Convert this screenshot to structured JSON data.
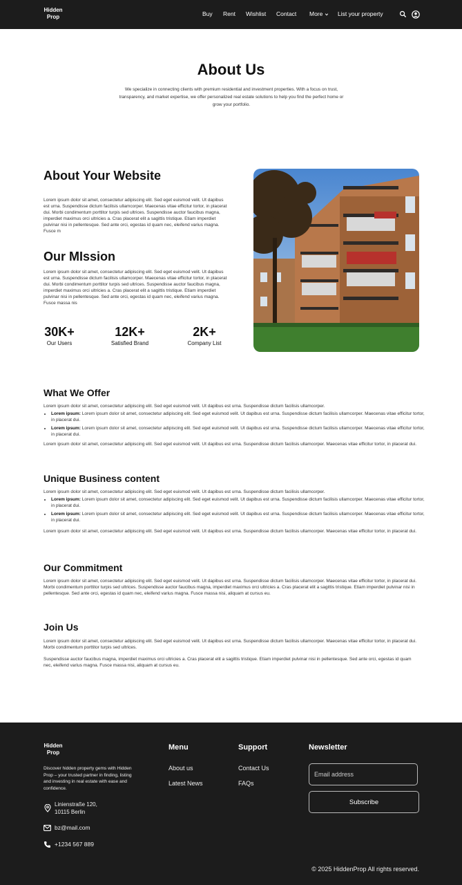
{
  "header": {
    "logo_line1": "Hidden",
    "logo_line2": "Prop",
    "nav": [
      "Buy",
      "Rent",
      "Wishlist",
      "Contact",
      "More",
      "List your property"
    ]
  },
  "hero": {
    "title": "About Us",
    "text": "We specialize in connecting clients with premium residential and investment properties. With a focus on trust, transparency, and market expertise, we offer personalized real estate solutions to help you find the perfect home or grow your portfolio."
  },
  "about": {
    "title": "About Your Website",
    "text": "Lorem ipsum dolor sit amet, consectetur adipiscing elit. Sed eget euismod velit. Ut dapibus est urna. Suspendisse dictum facilisis ullamcorper. Maecenas vitae efficitur tortor, in placerat dui. Morbi condimentum porttitor turpis sed ultrices. Suspendisse auctor faucibus magna, imperdiet maximus orci ultricies a. Cras placerat elit a sagittis tristique. Etiam imperdiet pulvinar nisi in pellentesque. Sed ante orci, egestas id quam nec, eleifend varius magna. Fusce m",
    "mission_title": "Our MIssion",
    "mission_text": "Lorem ipsum dolor sit amet, consectetur adipiscing elit. Sed eget euismod velit. Ut dapibus est urna. Suspendisse dictum facilisis ullamcorper. Maecenas vitae efficitur tortor, in placerat dui. Morbi condimentum porttitor turpis sed ultrices. Suspendisse auctor faucibus magna, imperdiet maximus orci ultricies a. Cras placerat elit a sagittis tristique. Etiam imperdiet pulvinar nisi in pellentesque. Sed ante orci, egestas id quam nec, eleifend varius magna. Fusce massa nis"
  },
  "stats": [
    {
      "value": "30K+",
      "label": "Our Users"
    },
    {
      "value": "12K+",
      "label": "Satisfied Brand"
    },
    {
      "value": "2K+",
      "label": "Company List"
    }
  ],
  "offer": {
    "title": "What We Offer",
    "intro": "Lorem ipsum dolor sit amet, consectetur adipiscing elit. Sed eget euismod velit. Ut dapibus est urna. Suspendisse dictum facilisis ullamcorper.",
    "bullet_label": "Lorem ipsum:",
    "bullet_text": "Lorem ipsum dolor sit amet, consectetur adipiscing elit. Sed eget euismod velit. Ut dapibus est urna. Suspendisse dictum facilisis ullamcorper. Maecenas vitae efficitur tortor, in placerat dui.",
    "outro": "Lorem ipsum dolor sit amet, consectetur adipiscing elit. Sed eget euismod velit. Ut dapibus est urna. Suspendisse dictum facilisis ullamcorper. Maecenas vitae efficitur tortor, in placerat dui."
  },
  "unique": {
    "title": "Unique Business content"
  },
  "commitment": {
    "title": "Our Commitment",
    "text": "Lorem ipsum dolor sit amet, consectetur adipiscing elit. Sed eget euismod velit. Ut dapibus est urna. Suspendisse dictum facilisis ullamcorper. Maecenas vitae efficitur tortor, in placerat dui. Morbi condimentum porttitor turpis sed ultrices. Suspendisse auctor faucibus magna, imperdiet maximus orci ultricies a. Cras placerat elit a sagittis tristique. Etiam imperdiet pulvinar nisi in pellentesque. Sed ante orci, egestas id quam nec, eleifend varius magna. Fusce massa nisi, aliquam at cursus eu."
  },
  "join": {
    "title": "Join Us",
    "text1": "Lorem ipsum dolor sit amet, consectetur adipiscing elit. Sed eget euismod velit. Ut dapibus est urna. Suspendisse dictum facilisis ullamcorper. Maecenas vitae efficitur tortor, in placerat dui. Morbi condimentum porttitor turpis sed ultrices.",
    "text2": "Suspendisse auctor faucibus magna, imperdiet maximus orci ultricies a. Cras placerat elit a sagittis tristique. Etiam imperdiet pulvinar nisi in pellentesque. Sed ante orci, egestas id quam nec, eleifend varius magna. Fusce massa nisi, aliquam at cursus eu."
  },
  "footer": {
    "logo_line1": "Hidden",
    "logo_line2": "Prop",
    "description": "Discover hidden property gems with Hidden Prop – your trusted partner in finding, listing and investing in real estate with ease and confidence.",
    "address_line1": "Linienstraße 120,",
    "address_line2": "10115 Berlin",
    "email": "bz@mail.com",
    "phone": "+1234 567 889",
    "menu_title": "Menu",
    "menu_items": [
      "About us",
      "Latest News"
    ],
    "support_title": "Support",
    "support_items": [
      "Contact Us",
      "FAQs"
    ],
    "newsletter_title": "Newsletter",
    "email_placeholder": "Email address",
    "subscribe_label": "Subscribe",
    "copyright": "© 2025 HiddenProp All rights reserved."
  }
}
